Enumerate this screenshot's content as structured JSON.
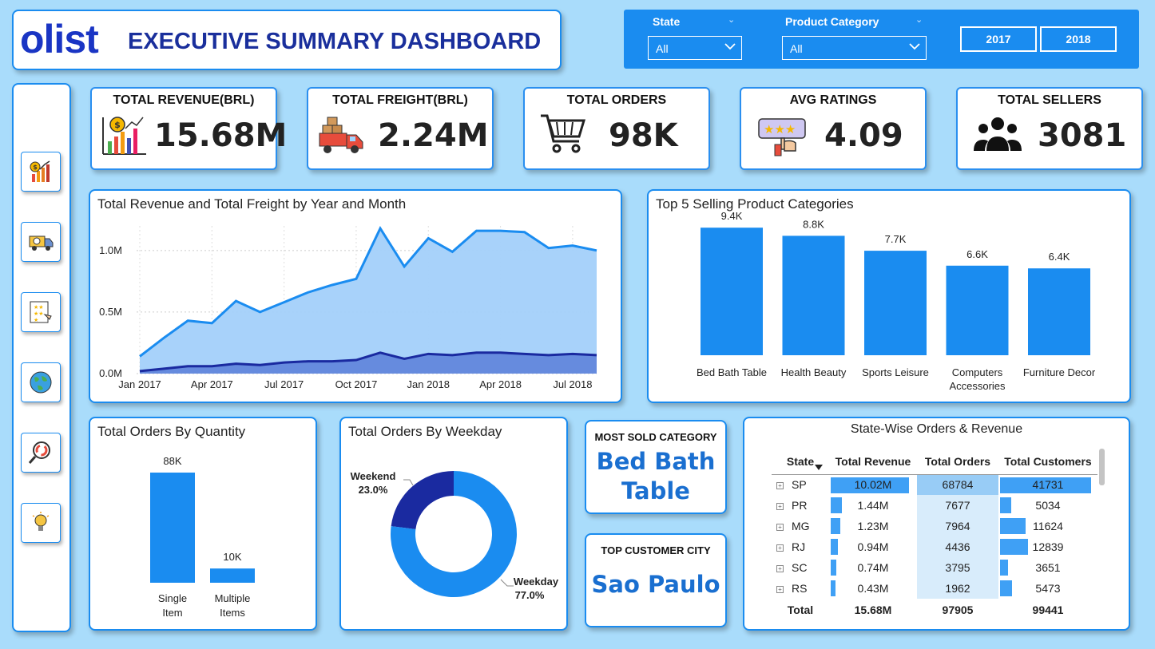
{
  "header": {
    "logo": "olist",
    "title": "EXECUTIVE SUMMARY DASHBOARD"
  },
  "filters": {
    "state_label": "State",
    "state_value": "All",
    "category_label": "Product Category",
    "category_value": "All",
    "years": [
      "2017",
      "2018"
    ]
  },
  "sidebar": {
    "items": [
      "revenue-chart-icon",
      "delivery-truck-icon",
      "ratings-checklist-icon",
      "globe-icon",
      "search-analytics-icon",
      "lightbulb-icon"
    ]
  },
  "kpis": [
    {
      "label": "TOTAL REVENUE(BRL)",
      "value": "15.68M",
      "icon": "revenue-chart-icon"
    },
    {
      "label": "TOTAL FREIGHT(BRL)",
      "value": "2.24M",
      "icon": "delivery-truck-icon"
    },
    {
      "label": "TOTAL ORDERS",
      "value": "98K",
      "icon": "shopping-cart-icon"
    },
    {
      "label": "AVG RATINGS",
      "value": "4.09",
      "icon": "rating-stars-icon"
    },
    {
      "label": "TOTAL SELLERS",
      "value": "3081",
      "icon": "users-group-icon"
    }
  ],
  "colors": {
    "accent": "#1a8cf0",
    "navy": "#1a2f9c",
    "area_light": "#a3d0fa",
    "freight": "#1a2aa0",
    "bar": "#1a8cf0",
    "donut_dark": "#1a2aa0",
    "donut_light": "#1a8cf0"
  },
  "chart_data": [
    {
      "type": "area",
      "title": "Total Revenue and Total Freight by Year and Month",
      "x_ticks": [
        "Jan 2017",
        "Apr 2017",
        "Jul 2017",
        "Oct 2017",
        "Jan 2018",
        "Apr 2018",
        "Jul 2018"
      ],
      "y_ticks": [
        "0.0M",
        "0.5M",
        "1.0M"
      ],
      "ylim": [
        0,
        1.2
      ],
      "x": [
        "Jan 2017",
        "Feb 2017",
        "Mar 2017",
        "Apr 2017",
        "May 2017",
        "Jun 2017",
        "Jul 2017",
        "Aug 2017",
        "Sep 2017",
        "Oct 2017",
        "Nov 2017",
        "Dec 2017",
        "Jan 2018",
        "Feb 2018",
        "Mar 2018",
        "Apr 2018",
        "May 2018",
        "Jun 2018",
        "Jul 2018",
        "Aug 2018"
      ],
      "series": [
        {
          "values": [
            0.14,
            0.29,
            0.43,
            0.41,
            0.59,
            0.5,
            0.58,
            0.66,
            0.72,
            0.77,
            1.18,
            0.87,
            1.1,
            0.99,
            1.16,
            1.16,
            1.15,
            1.02,
            1.04,
            1.0
          ]
        },
        {
          "values": [
            0.02,
            0.04,
            0.06,
            0.06,
            0.08,
            0.07,
            0.09,
            0.1,
            0.1,
            0.11,
            0.17,
            0.12,
            0.16,
            0.15,
            0.17,
            0.17,
            0.16,
            0.15,
            0.16,
            0.15
          ]
        }
      ]
    },
    {
      "type": "bar",
      "title": "Top 5 Selling Product Categories",
      "categories": [
        "Bed Bath Table",
        "Health Beauty",
        "Sports Leisure",
        "Computers Accessories",
        "Furniture Decor"
      ],
      "category_lines": [
        [
          "Bed Bath Table"
        ],
        [
          "Health Beauty"
        ],
        [
          "Sports Leisure"
        ],
        [
          "Computers",
          "Accessories"
        ],
        [
          "Furniture Decor"
        ]
      ],
      "values": [
        9.4,
        8.8,
        7.7,
        6.6,
        6.4
      ],
      "labels": [
        "9.4K",
        "8.8K",
        "7.7K",
        "6.6K",
        "6.4K"
      ],
      "ylim": [
        0,
        10
      ]
    },
    {
      "type": "bar",
      "title": "Total Orders By Quantity",
      "categories": [
        "Single Item",
        "Multiple Items"
      ],
      "category_lines": [
        [
          "Single",
          "Item"
        ],
        [
          "Multiple",
          "Items"
        ]
      ],
      "values": [
        88,
        10
      ],
      "labels": [
        "88K",
        "10K"
      ],
      "ylim": [
        0,
        100
      ]
    },
    {
      "type": "pie",
      "title": "Total Orders By Weekday",
      "categories": [
        "Weekend",
        "Weekday"
      ],
      "values": [
        23.0,
        77.0
      ],
      "labels": [
        "23.0%",
        "77.0%"
      ]
    }
  ],
  "most_sold": {
    "label": "MOST SOLD CATEGORY",
    "value_line1": "Bed Bath",
    "value_line2": "Table"
  },
  "top_city": {
    "label": "TOP CUSTOMER CITY",
    "value": "Sao Paulo"
  },
  "state_table": {
    "title": "State-Wise Orders & Revenue",
    "columns": [
      "State",
      "Total Revenue",
      "Total Orders",
      "Total Customers"
    ],
    "rows": [
      {
        "state": "SP",
        "revenue": "10.02M",
        "revenue_num": 10.02,
        "orders": "68784",
        "customers": "41731",
        "customers_num": 41731
      },
      {
        "state": "PR",
        "revenue": "1.44M",
        "revenue_num": 1.44,
        "orders": "7677",
        "customers": "5034",
        "customers_num": 5034
      },
      {
        "state": "MG",
        "revenue": "1.23M",
        "revenue_num": 1.23,
        "orders": "7964",
        "customers": "11624",
        "customers_num": 11624
      },
      {
        "state": "RJ",
        "revenue": "0.94M",
        "revenue_num": 0.94,
        "orders": "4436",
        "customers": "12839",
        "customers_num": 12839
      },
      {
        "state": "SC",
        "revenue": "0.74M",
        "revenue_num": 0.74,
        "orders": "3795",
        "customers": "3651",
        "customers_num": 3651
      },
      {
        "state": "RS",
        "revenue": "0.43M",
        "revenue_num": 0.43,
        "orders": "1962",
        "customers": "5473",
        "customers_num": 5473
      }
    ],
    "total": {
      "label": "Total",
      "revenue": "15.68M",
      "orders": "97905",
      "customers": "99441"
    }
  }
}
